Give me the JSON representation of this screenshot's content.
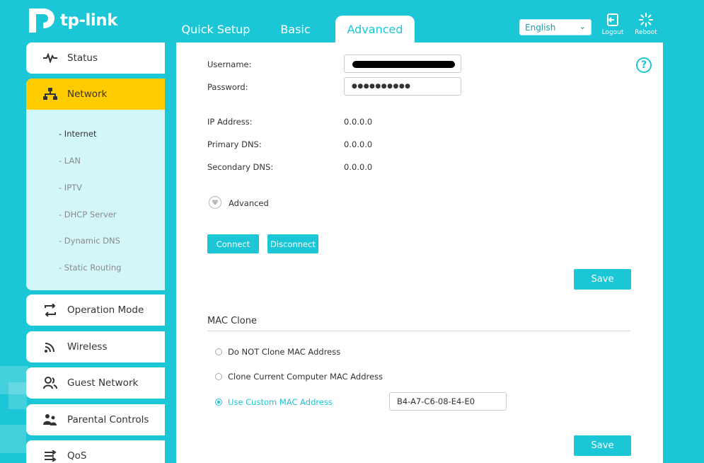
{
  "brand": {
    "name": "tp-link"
  },
  "top_tabs": [
    {
      "label": "Quick Setup"
    },
    {
      "label": "Basic"
    },
    {
      "label": "Advanced"
    }
  ],
  "header": {
    "language": "English",
    "logout_label": "Logout",
    "reboot_label": "Reboot"
  },
  "sidebar": {
    "items": [
      {
        "label": "Status",
        "icon": "status-pulse-icon"
      },
      {
        "label": "Network",
        "icon": "network-icon"
      },
      {
        "label": "Operation Mode",
        "icon": "operation-mode-icon"
      },
      {
        "label": "Wireless",
        "icon": "wireless-icon"
      },
      {
        "label": "Guest Network",
        "icon": "guest-network-icon"
      },
      {
        "label": "Parental Controls",
        "icon": "parental-controls-icon"
      },
      {
        "label": "QoS",
        "icon": "qos-icon"
      }
    ],
    "submenu": [
      {
        "label": "- Internet"
      },
      {
        "label": "- LAN"
      },
      {
        "label": "- IPTV"
      },
      {
        "label": "- DHCP Server"
      },
      {
        "label": "- Dynamic DNS"
      },
      {
        "label": "- Static Routing"
      }
    ]
  },
  "form": {
    "username_label": "Username:",
    "password_label": "Password:",
    "password_value": "●●●●●●●●●●",
    "ip_label": "IP Address:",
    "ip_value": "0.0.0.0",
    "primary_dns_label": "Primary DNS:",
    "primary_dns_value": "0.0.0.0",
    "secondary_dns_label": "Secondary DNS:",
    "secondary_dns_value": "0.0.0.0",
    "advanced_label": "Advanced",
    "connect_label": "Connect",
    "disconnect_label": "Disconnect",
    "save_label": "Save"
  },
  "mac_clone": {
    "title": "MAC Clone",
    "options": [
      {
        "label": "Do NOT Clone MAC Address",
        "selected": false
      },
      {
        "label": "Clone Current Computer MAC Address",
        "selected": false
      },
      {
        "label": "Use Custom MAC Address",
        "selected": true
      }
    ],
    "custom_mac_value": "B4-A7-C6-08-E4-E0",
    "save_label": "Save"
  },
  "colors": {
    "accent": "#1bc6d6",
    "active_nav": "#ffcc00",
    "submenu_bg": "#d3f6f9"
  }
}
